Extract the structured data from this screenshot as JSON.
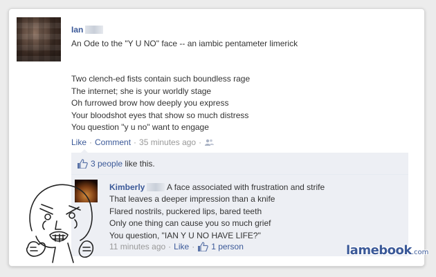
{
  "post": {
    "author": "Ian",
    "title": "An Ode to the \"Y U NO\" face -- an iambic pentameter limerick",
    "lines": [
      "Two clench-ed fists contain such boundless rage",
      "The internet; she is your worldly stage",
      "Oh furrowed brow how deeply you express",
      "Your bloodshot eyes that show so much distress",
      "You question \"y u no\" want to engage"
    ],
    "actions": {
      "like": "Like",
      "comment": "Comment",
      "time": "35 minutes ago"
    },
    "icons": {
      "audience": "friends-icon"
    }
  },
  "likes": {
    "count_label": "3 people",
    "suffix": "like this.",
    "icon": "thumbs-up-icon"
  },
  "comment": {
    "author": "Kimberly",
    "first_line": "A face associated with frustration and strife",
    "lines": [
      "That leaves a deeper impression than a knife",
      "Flared nostrils, puckered lips, bared teeth",
      "Only one thing can cause you so much grief",
      "You question, \"IAN Y U NO HAVE LIFE?\""
    ],
    "time": "11 minutes ago",
    "like": "Like",
    "like_count": "1 person"
  },
  "watermark": {
    "brand": "lamebook",
    "tld": ".com"
  },
  "colors": {
    "link": "#3b5998",
    "muted": "#999999",
    "box": "#edeff4"
  }
}
